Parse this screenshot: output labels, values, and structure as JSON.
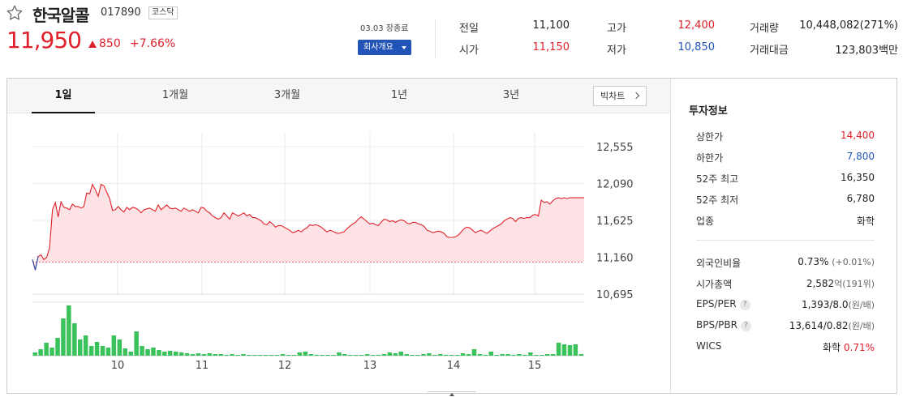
{
  "stock": {
    "name": "한국알콜",
    "code": "017890",
    "market": "코스닥",
    "price": "11,950",
    "change": "850",
    "change_pct": "+7.66%",
    "date": "03.03 장종료",
    "company_button": "회사개요"
  },
  "summary": {
    "prev_label": "전일",
    "prev": "11,100",
    "high_label": "고가",
    "high": "12,400",
    "volume_label": "거래량",
    "volume": "10,448,082(271%)",
    "open_label": "시가",
    "open": "11,150",
    "low_label": "저가",
    "low": "10,850",
    "amount_label": "거래대금",
    "amount": "123,803백만"
  },
  "tabs": [
    "1일",
    "1개월",
    "3개월",
    "1년",
    "3년"
  ],
  "active_tab": 0,
  "big_chart_button": "빅차트",
  "colors": {
    "up": "#e0202a",
    "down": "#2154b6",
    "volume": "#3cc25c",
    "area": "#fde3e5"
  },
  "chart_data": {
    "type": "line",
    "x_ticks": [
      "10",
      "11",
      "12",
      "13",
      "14",
      "15"
    ],
    "y_ticks": [
      "12,555",
      "12,090",
      "11,625",
      "11,160",
      "10,695"
    ],
    "ylim": [
      10695,
      12555
    ],
    "prev_close": 11100,
    "price_series": [
      11130,
      11000,
      11170,
      11190,
      11130,
      11160,
      11280,
      11760,
      11850,
      11670,
      11860,
      11790,
      11780,
      11760,
      11830,
      11800,
      11800,
      11780,
      11800,
      11970,
      11960,
      12080,
      12010,
      11930,
      12080,
      12060,
      11980,
      11900,
      11750,
      11760,
      11800,
      11760,
      11730,
      11790,
      11760,
      11790,
      11780,
      11760,
      11720,
      11760,
      11770,
      11780,
      11760,
      11740,
      11820,
      11760,
      11790,
      11820,
      11780,
      11770,
      11780,
      11760,
      11740,
      11780,
      11760,
      11740,
      11760,
      11740,
      11720,
      11790,
      11780,
      11740,
      11720,
      11680,
      11660,
      11640,
      11660,
      11720,
      11680,
      11640,
      11720,
      11700,
      11680,
      11700,
      11720,
      11680,
      11700,
      11660,
      11660,
      11640,
      11620,
      11580,
      11570,
      11610,
      11580,
      11540,
      11560,
      11560,
      11540,
      11520,
      11500,
      11470,
      11480,
      11500,
      11480,
      11510,
      11530,
      11570,
      11560,
      11570,
      11560,
      11540,
      11510,
      11480,
      11500,
      11490,
      11470,
      11460,
      11470,
      11480,
      11520,
      11550,
      11580,
      11600,
      11640,
      11670,
      11640,
      11610,
      11580,
      11590,
      11570,
      11560,
      11600,
      11640,
      11630,
      11610,
      11620,
      11600,
      11620,
      11630,
      11620,
      11590,
      11580,
      11600,
      11600,
      11580,
      11570,
      11550,
      11500,
      11490,
      11470,
      11480,
      11490,
      11480,
      11460,
      11420,
      11410,
      11410,
      11420,
      11440,
      11480,
      11520,
      11540,
      11530,
      11500,
      11470,
      11490,
      11500,
      11480,
      11460,
      11490,
      11520,
      11540,
      11560,
      11580,
      11620,
      11640,
      11660,
      11650,
      11610,
      11650,
      11660,
      11650,
      11660,
      11660,
      11690,
      11700,
      11680,
      11880,
      11850,
      11860,
      11830,
      11870,
      11900,
      11910,
      11900,
      11910,
      11900,
      11910,
      11910,
      11910,
      11910,
      11910,
      11910
    ],
    "volume_series": [
      4,
      8,
      16,
      10,
      22,
      46,
      62,
      40,
      20,
      25,
      12,
      17,
      12,
      10,
      25,
      20,
      9,
      5,
      30,
      12,
      8,
      10,
      7,
      5,
      6,
      5,
      4,
      3,
      2,
      3,
      2,
      3,
      2,
      2,
      1,
      2,
      1,
      2,
      1,
      1,
      1,
      1,
      1,
      1,
      2,
      1,
      1,
      4,
      5,
      2,
      1,
      1,
      1,
      1,
      4,
      2,
      1,
      1,
      1,
      2,
      1,
      1,
      2,
      4,
      3,
      5,
      2,
      1,
      1,
      2,
      3,
      1,
      2,
      1,
      1,
      1,
      3,
      2,
      8,
      2,
      1,
      5,
      1,
      2,
      2,
      1,
      2,
      1,
      4,
      1,
      1,
      2,
      2,
      16,
      14,
      13,
      14,
      2
    ]
  },
  "invest": {
    "title": "투자정보",
    "upper_label": "상한가",
    "upper": "14,400",
    "lower_label": "하한가",
    "lower": "7,800",
    "high52_label": "52주 최고",
    "high52": "16,350",
    "low52_label": "52주 최저",
    "low52": "6,780",
    "industry_label": "업종",
    "industry": "화학",
    "foreign_label": "외국인비율",
    "foreign": "0.73%",
    "foreign_chg": "(+0.01%)",
    "mcap_label": "시가총액",
    "mcap": "2,582",
    "mcap_unit": "억(191위)",
    "eps_label": "EPS/PER",
    "eps": "1,393/8.0",
    "eps_unit": "(원/배)",
    "bps_label": "BPS/PBR",
    "bps": "13,614/0.82",
    "bps_unit": "(원/배)",
    "wics_label": "WICS",
    "wics": "화학",
    "wics_pct": "0.71%"
  }
}
